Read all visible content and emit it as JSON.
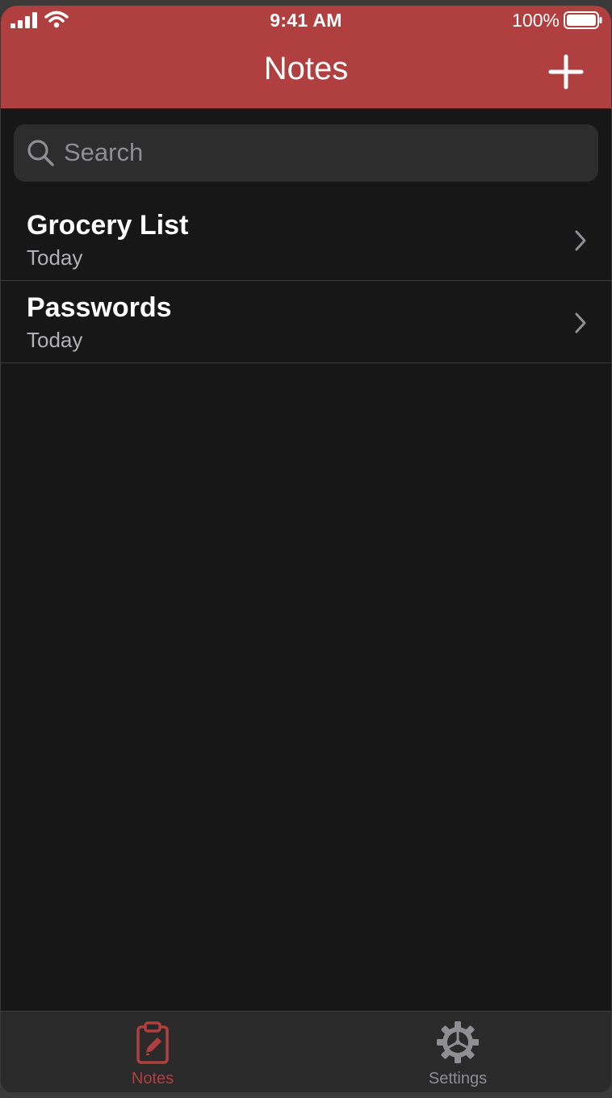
{
  "status_bar": {
    "time": "9:41 AM",
    "battery_percent": "100%"
  },
  "nav": {
    "title": "Notes",
    "add_icon": "plus-icon"
  },
  "search": {
    "placeholder": "Search",
    "value": ""
  },
  "notes": [
    {
      "title": "Grocery List",
      "date": "Today"
    },
    {
      "title": "Passwords",
      "date": "Today"
    }
  ],
  "tab_bar": {
    "tabs": [
      {
        "label": "Notes",
        "icon": "clipboard-edit-icon",
        "selected": true
      },
      {
        "label": "Settings",
        "icon": "gear-icon",
        "selected": false
      }
    ]
  },
  "colors": {
    "accent": "#b03f3f",
    "background": "#171717",
    "tab_inactive": "#8e8e93"
  }
}
